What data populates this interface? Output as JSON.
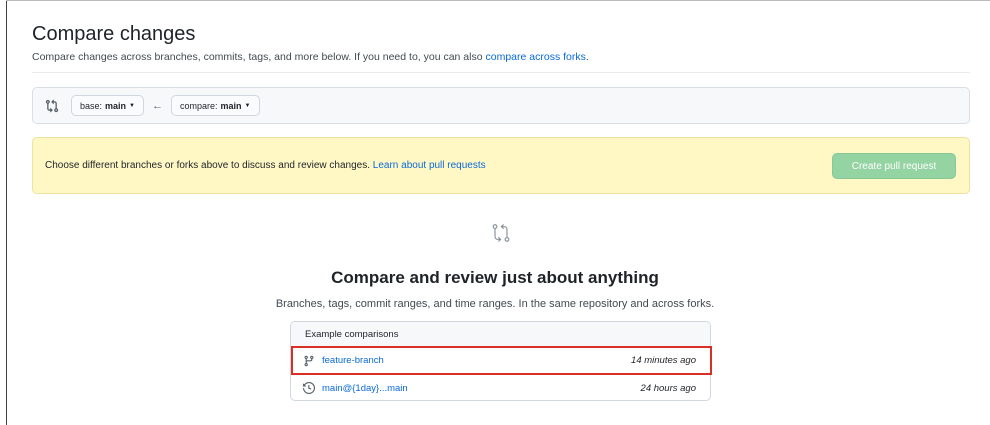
{
  "header": {
    "title": "Compare changes",
    "subtitle_prefix": "Compare changes across branches, commits, tags, and more below. If you need to, you can also ",
    "subtitle_link": "compare across forks",
    "subtitle_suffix": "."
  },
  "range": {
    "base_prefix": "base:",
    "base_value": "main",
    "compare_prefix": "compare:",
    "compare_value": "main"
  },
  "flash": {
    "message": "Choose different branches or forks above to discuss and review changes. ",
    "link": "Learn about pull requests",
    "create_button": "Create pull request"
  },
  "blankslate": {
    "title": "Compare and review just about anything",
    "subtitle": "Branches, tags, commit ranges, and time ranges. In the same repository and across forks."
  },
  "examples": {
    "header": "Example comparisons",
    "items": [
      {
        "label": "feature-branch",
        "time": "14 minutes ago",
        "icon": "git-branch-icon"
      },
      {
        "label": "main@{1day}...main",
        "time": "24 hours ago",
        "icon": "history-icon"
      }
    ]
  },
  "colors": {
    "link": "#0969da",
    "flash_bg": "#fff8c5",
    "create_button_bg": "#94d3a2",
    "highlight": "#d93025"
  }
}
